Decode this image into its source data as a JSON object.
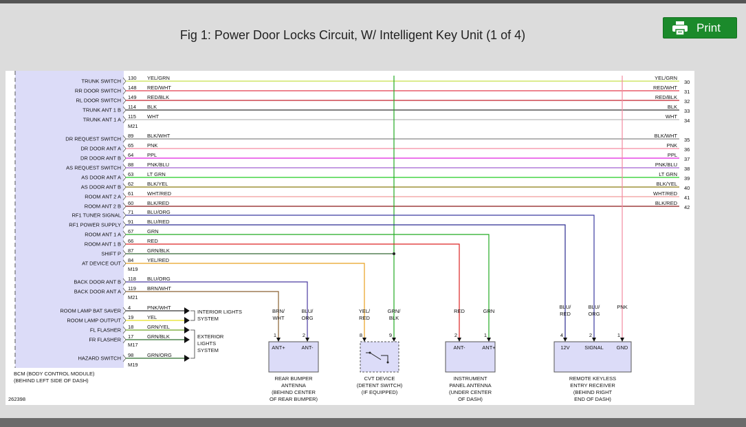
{
  "page_title": "Fig 1: Power Door Locks Circuit, W/ Intelligent Key Unit (1 of 4)",
  "print_label": "Print",
  "diagram": {
    "figure_id": "262398",
    "bcm_label_1": "BCM (BODY CONTROL MODULE)",
    "bcm_label_2": "(BEHIND LEFT SIDE OF DASH)",
    "connectors": {
      "m21a": "M21",
      "m19a": "M19",
      "m21b": "M21",
      "m17": "M17",
      "m19b": "M19"
    },
    "rows": [
      {
        "label": "TRUNK SWITCH",
        "pin": "130",
        "wire": "YEL/GRN",
        "rwire": "YEL/GRN",
        "rpin": "30",
        "color": "#c8e04a"
      },
      {
        "label": "RR DOOR SWITCH",
        "pin": "148",
        "wire": "RED/WHT",
        "rwire": "RED/WHT",
        "rpin": "31",
        "color": "#e23a4a"
      },
      {
        "label": "RL DOOR SWITCH",
        "pin": "149",
        "wire": "RED/BLK",
        "rwire": "RED/BLK",
        "rpin": "32",
        "color": "#c4222c"
      },
      {
        "label": "TRUNK ANT 1 B",
        "pin": "114",
        "wire": "BLK",
        "rwire": "BLK",
        "rpin": "33",
        "color": "#333333"
      },
      {
        "label": "TRUNK ANT 1 A",
        "pin": "115",
        "wire": "WHT",
        "rwire": "WHT",
        "rpin": "34",
        "color": "#bbbbbb"
      },
      {
        "label": "DR REQUEST SWITCH",
        "pin": "89",
        "wire": "BLK/WHT",
        "rwire": "BLK/WHT",
        "rpin": "35",
        "color": "#888888"
      },
      {
        "label": "DR DOOR ANT A",
        "pin": "65",
        "wire": "PNK",
        "rwire": "PNK",
        "rpin": "36",
        "color": "#f48aa0"
      },
      {
        "label": "DR DOOR ANT B",
        "pin": "64",
        "wire": "PPL",
        "rwire": "PPL",
        "rpin": "37",
        "color": "#e020e0"
      },
      {
        "label": "AS REQUEST SWITCH",
        "pin": "88",
        "wire": "PNK/BLU",
        "rwire": "PNK/BLU",
        "rpin": "38",
        "color": "#a060d0"
      },
      {
        "label": "AS DOOR ANT A",
        "pin": "63",
        "wire": "LT GRN",
        "rwire": "LT GRN",
        "rpin": "39",
        "color": "#22cc22"
      },
      {
        "label": "AS DOOR ANT B",
        "pin": "62",
        "wire": "BLK/YEL",
        "rwire": "BLK/YEL",
        "rpin": "40",
        "color": "#8a7a10"
      },
      {
        "label": "ROOM ANT 2 A",
        "pin": "61",
        "wire": "WHT/RED",
        "rwire": "WHT/RED",
        "rpin": "41",
        "color": "#f09a9a"
      },
      {
        "label": "ROOM ANT 2 B",
        "pin": "60",
        "wire": "BLK/RED",
        "rwire": "BLK/RED",
        "rpin": "42",
        "color": "#8a1818"
      },
      {
        "label": "RF1 TUNER SIGNAL",
        "pin": "71",
        "wire": "BLU/ORG",
        "color": "#3a3aa0"
      },
      {
        "label": "RF1 POWER SUPPLY",
        "pin": "91",
        "wire": "BLU/RED",
        "color": "#3a3aa0"
      },
      {
        "label": "ROOM ANT 1 A",
        "pin": "67",
        "wire": "GRN",
        "color": "#22aa22"
      },
      {
        "label": "ROOM ANT 1 B",
        "pin": "66",
        "wire": "RED",
        "color": "#dd2222"
      },
      {
        "label": "SHIFT P",
        "pin": "87",
        "wire": "GRN/BLK",
        "color": "#336633"
      },
      {
        "label": "AT DEVICE OUT",
        "pin": "84",
        "wire": "YEL/RED",
        "color": "#e8a020"
      },
      {
        "label": "BACK DOOR ANT B",
        "pin": "118",
        "wire": "BLU/ORG",
        "color": "#4a3aa0"
      },
      {
        "label": "BACK DOOR ANT A",
        "pin": "119",
        "wire": "BRN/WHT",
        "color": "#8a6030"
      },
      {
        "label": "ROOM LAMP BAT SAVER",
        "pin": "4",
        "wire": "PNK/WHT",
        "color": "#333333"
      },
      {
        "label": "ROOM LAMP OUTPUT",
        "pin": "19",
        "wire": "YEL",
        "color": "#e8e020"
      },
      {
        "label": "FL FLASHER",
        "pin": "18",
        "wire": "GRN/YEL",
        "color": "#6aa020"
      },
      {
        "label": "FR FLASHER",
        "pin": "17",
        "wire": "GRN/BLK",
        "color": "#2a6a2a"
      },
      {
        "label": "HAZARD SWITCH",
        "pin": "98",
        "wire": "GRN/ORG",
        "color": "#2a6a2a"
      }
    ],
    "interior_lights": [
      "INTERIOR LIGHTS",
      "SYSTEM"
    ],
    "exterior_lights": [
      "EXTERIOR",
      "LIGHTS",
      "SYSTEM"
    ],
    "modules": {
      "rear_bumper": {
        "wires": [
          [
            "BRN/",
            "WHT"
          ],
          [
            "BLU/",
            "ORG"
          ]
        ],
        "pins": [
          "1",
          "2"
        ],
        "terminals": [
          "ANT+",
          "ANT-"
        ],
        "caption": [
          "REAR BUMPER",
          "ANTENNA",
          "(BEHIND CENTER",
          "OF REAR BUMPER)"
        ]
      },
      "cvt": {
        "wires": [
          [
            "YEL/",
            "RED"
          ],
          [
            "GRN/",
            "BLK"
          ]
        ],
        "pins": [
          "8",
          "9"
        ],
        "caption": [
          "CVT DEVICE",
          "(DETENT SWITCH)",
          "(IF EQUIPPED)"
        ]
      },
      "panel_antenna": {
        "wires": [
          [
            "RED"
          ],
          [
            "GRN"
          ]
        ],
        "pins": [
          "2",
          "1"
        ],
        "terminals": [
          "ANT-",
          "ANT+"
        ],
        "caption": [
          "INSTRUMENT",
          "PANEL ANTENNA",
          "(UNDER CENTER",
          "OF DASH)"
        ]
      },
      "rke": {
        "wires": [
          [
            "BLU/",
            "RED"
          ],
          [
            "BLU/",
            "ORG"
          ],
          [
            "PNK"
          ]
        ],
        "pins": [
          "4",
          "2",
          "1"
        ],
        "terminals": [
          "12V",
          "SIGNAL",
          "GND"
        ],
        "caption": [
          "REMOTE KEYLESS",
          "ENTRY RECEIVER",
          "(BEHIND RIGHT",
          "END OF DASH)"
        ]
      }
    }
  }
}
